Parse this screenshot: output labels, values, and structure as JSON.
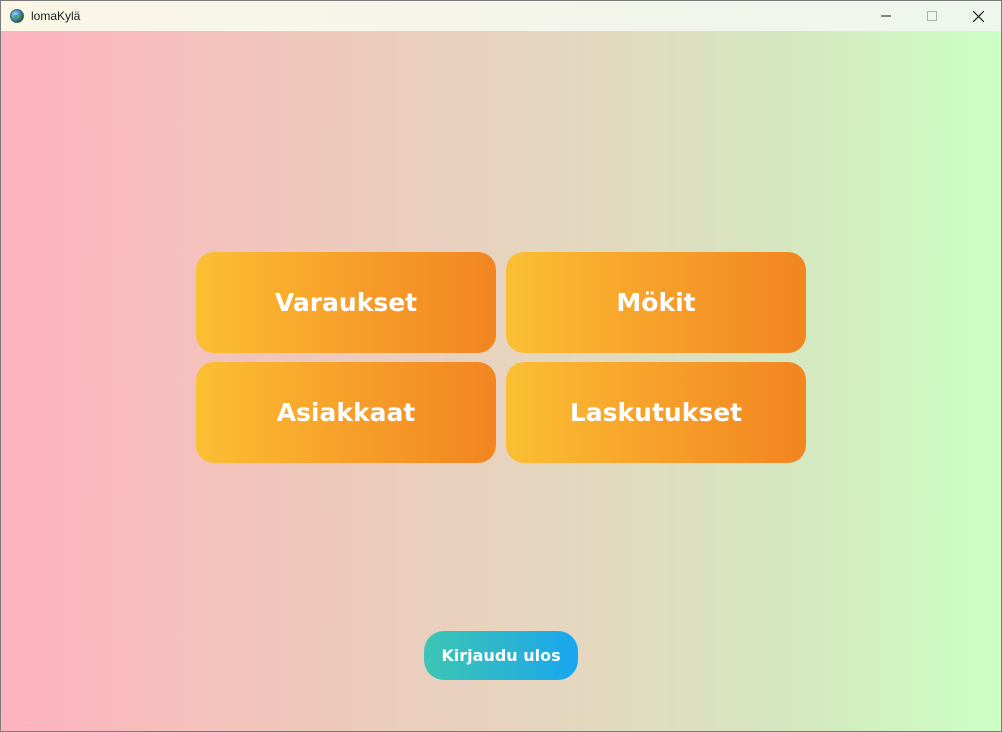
{
  "window": {
    "title": "lomaKylä",
    "app_icon": "globe-icon",
    "controls": [
      "minimize-icon",
      "maximize-icon",
      "close-icon"
    ]
  },
  "tiles": [
    {
      "label": "Varaukset"
    },
    {
      "label": "Mökit"
    },
    {
      "label": "Asiakkaat"
    },
    {
      "label": "Laskutukset"
    }
  ],
  "logout": {
    "label": "Kirjaudu ulos"
  },
  "colors": {
    "background_left": "#ffb3be",
    "background_right": "#ccffc4",
    "tile_start": "#fbbf33",
    "tile_end": "#f28520",
    "logout_start": "#3cc6b4",
    "logout_end": "#18a6f3",
    "button_text": "#ffffff"
  }
}
